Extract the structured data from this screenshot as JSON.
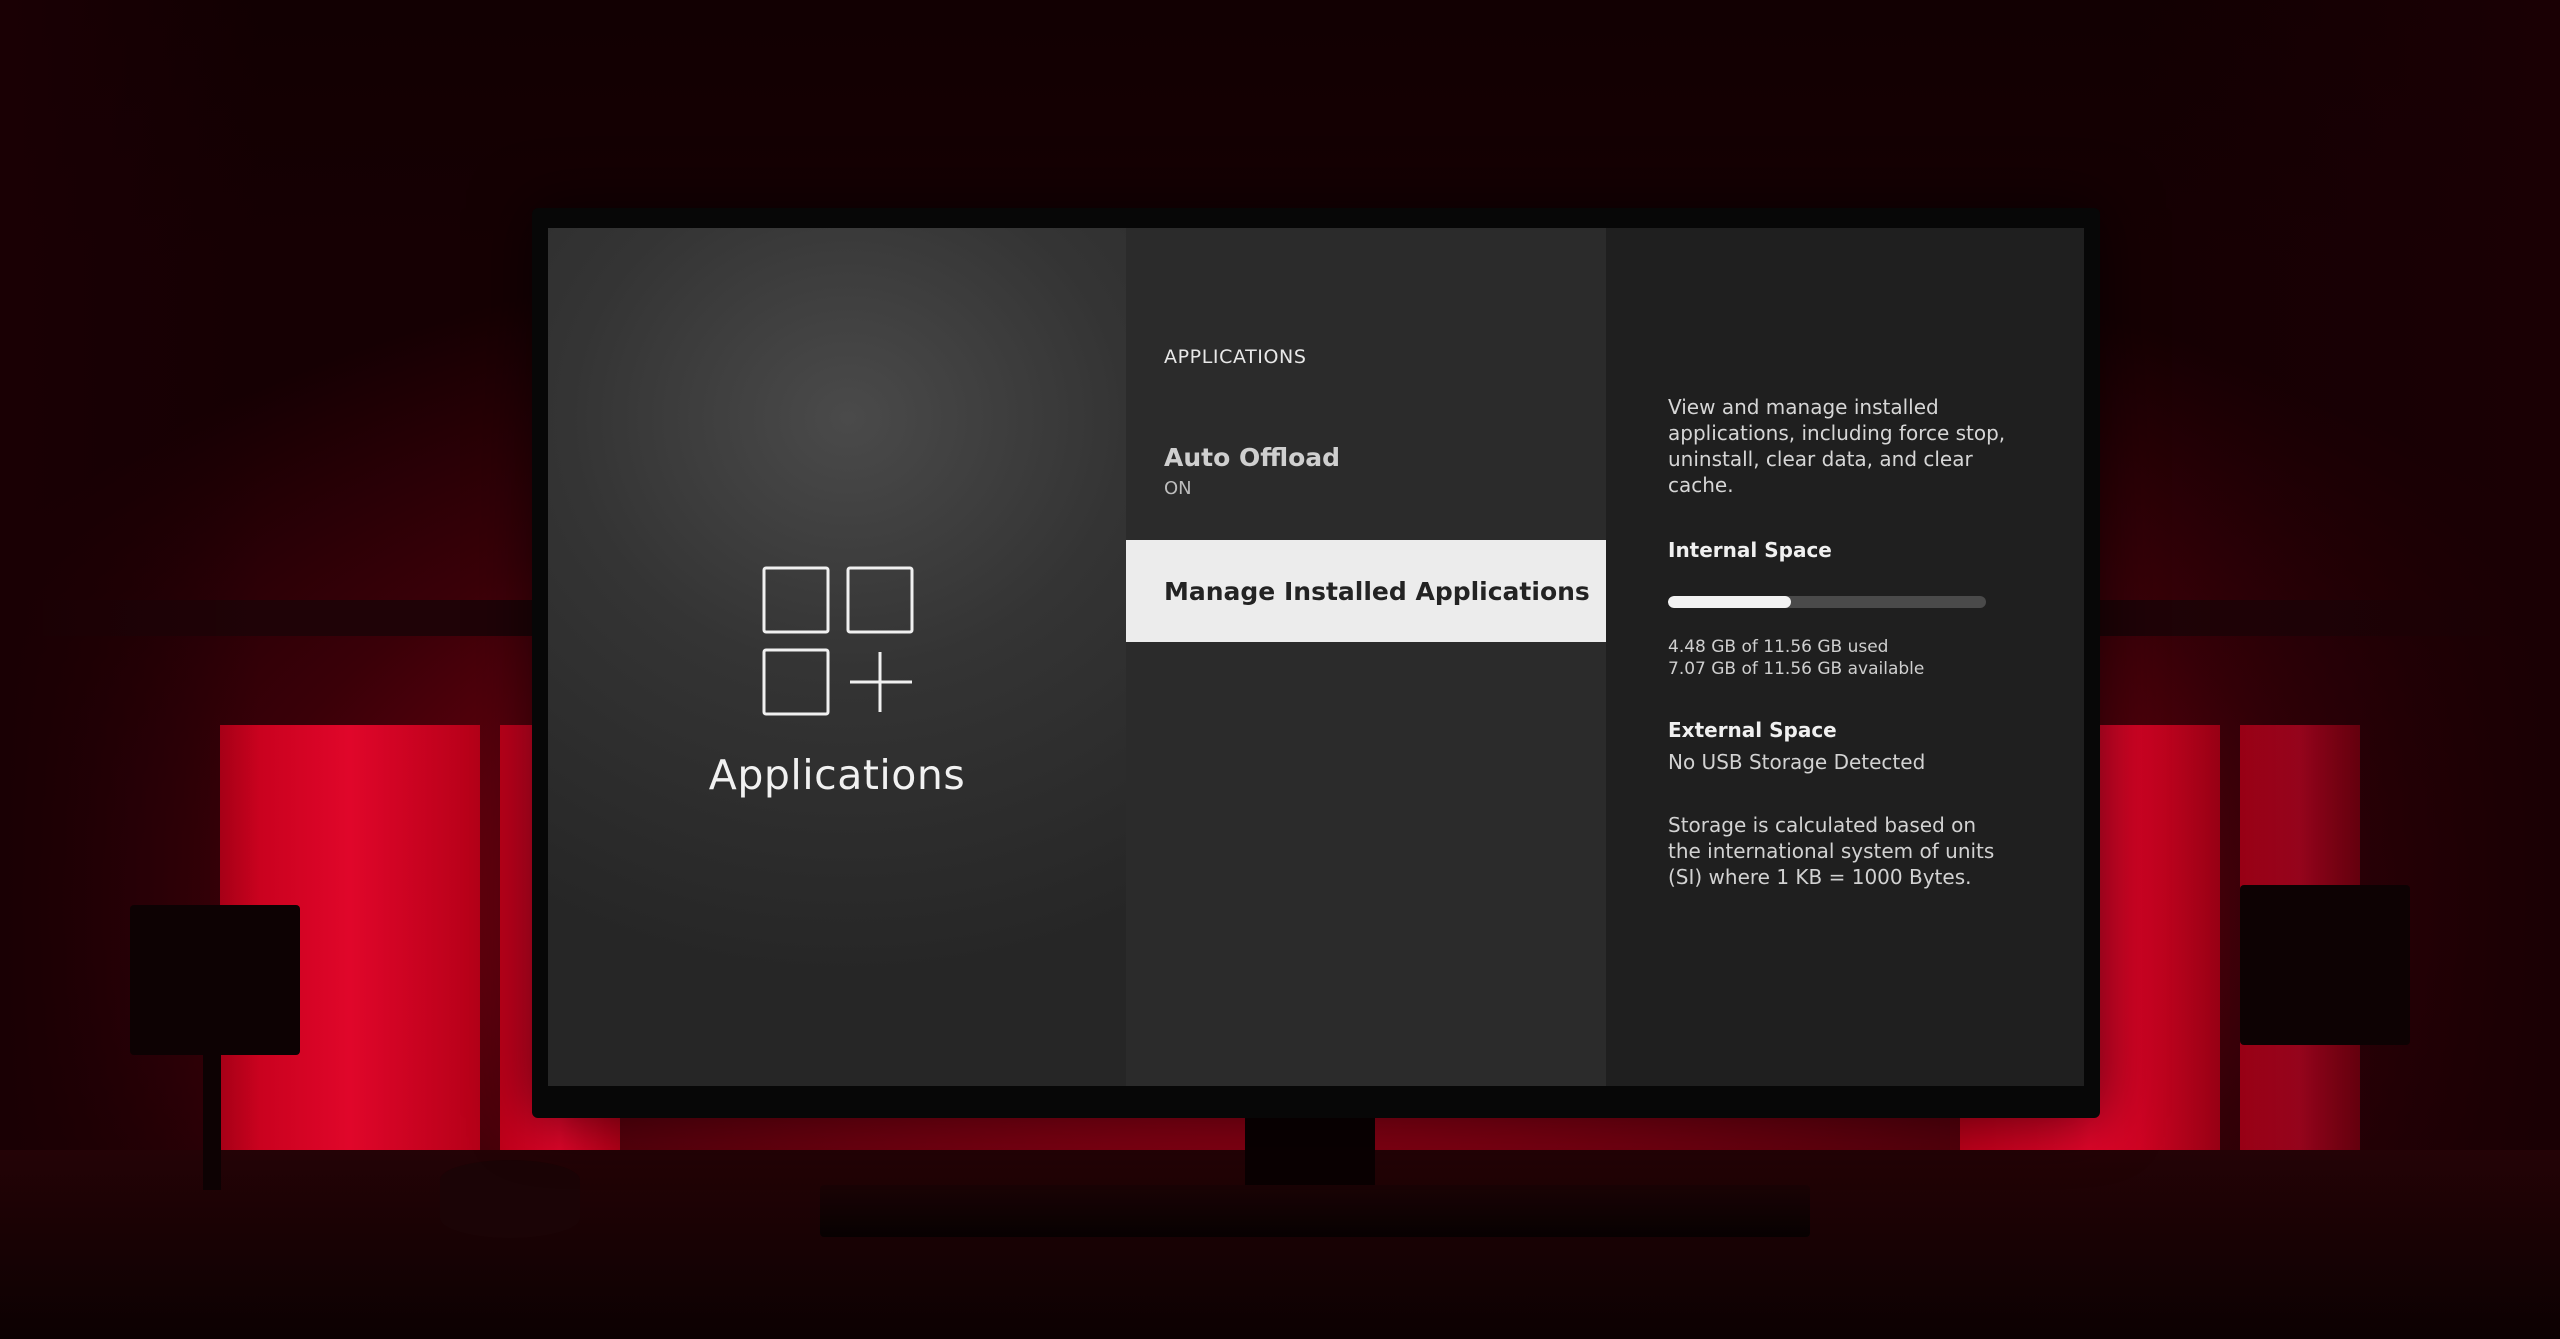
{
  "category": {
    "title": "Applications",
    "icon": "apps-grid-plus-icon"
  },
  "menu": {
    "header": "APPLICATIONS",
    "items": [
      {
        "label": "Auto Offload",
        "value": "ON",
        "selected": false
      },
      {
        "label": "Manage Installed Applications",
        "selected": true
      }
    ]
  },
  "info": {
    "description": "View and manage installed applications, including force stop, uninstall, clear data, and clear cache.",
    "internal": {
      "heading": "Internal Space",
      "used_fraction": 0.3875,
      "used": "4.48 GB of 11.56 GB used",
      "available": "7.07 GB of 11.56 GB available"
    },
    "external": {
      "heading": "External Space",
      "value": "No USB Storage Detected"
    },
    "note": "Storage is calculated based on the international system of units (SI) where 1 KB = 1000 Bytes."
  },
  "colors": {
    "ambient_red": "#d0001f",
    "selected_bg": "#ececec",
    "bar_fill": "#f2f2f2",
    "bar_track": "#4a4a4a"
  }
}
